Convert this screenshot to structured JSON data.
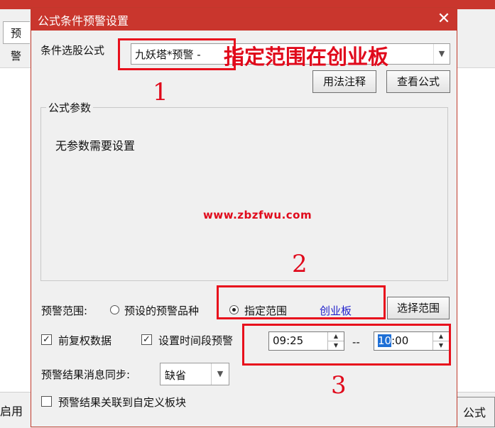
{
  "background": {
    "tab_label": "预警",
    "enable_label": "启用",
    "formula_button": "公式"
  },
  "dialog": {
    "title": "公式条件预警设置",
    "close_glyph": "✕",
    "formula_label": "条件选股公式",
    "formula_value": "九妖塔*预警  -",
    "usage_button": "用法注释",
    "view_formula_button": "查看公式",
    "params_group_title": "公式参数",
    "params_message": "无参数需要设置",
    "watermark": "www.zbzfwu.com",
    "range_label": "预警范围:",
    "range_option_preset": "预设的预警品种",
    "range_option_specified": "指定范围",
    "range_selected_value": "创业板",
    "select_range_button": "选择范围",
    "check_forward_adjusted": "前复权数据",
    "check_time_period": "设置时间段预警",
    "time_start": "09:25",
    "time_separator": "--",
    "time_end_hour": "10",
    "time_end_rest": ":00",
    "sync_label": "预警结果消息同步:",
    "sync_value": "缺省",
    "link_block_label": "预警结果关联到自定义板块"
  },
  "annotations": {
    "banner": "指定范围在创业板",
    "num1": "1",
    "num2": "2",
    "num3": "3",
    "color": "#e8101c"
  }
}
